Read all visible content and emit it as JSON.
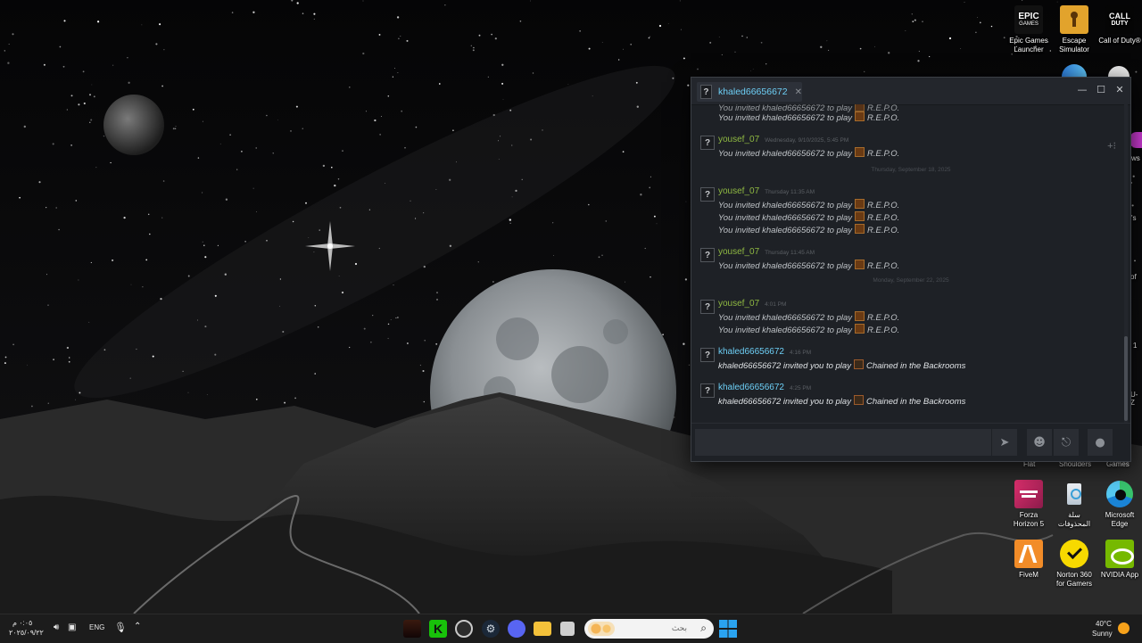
{
  "desktop_icons": [
    {
      "label": "Epic Games Launcher",
      "icon": "epic-games-icon"
    },
    {
      "label": "Escape Simulator",
      "icon": "escape-simulator-icon"
    },
    {
      "label": "Call of Duty®",
      "icon": "call-of-duty-icon"
    },
    {
      "label": "Flat",
      "icon": "flat-icon"
    },
    {
      "label": "Shoulders",
      "icon": "shoulders-icon"
    },
    {
      "label": "Games",
      "icon": "games-icon"
    },
    {
      "label": "Forza Horizon 5",
      "icon": "forza-horizon-icon"
    },
    {
      "label": "سلة المحذوفات",
      "icon": "recycle-bin-icon"
    },
    {
      "label": "Microsoft Edge",
      "icon": "edge-icon"
    },
    {
      "label": "FiveM",
      "icon": "fivem-icon"
    },
    {
      "label": "Norton 360 for Gamers",
      "icon": "norton-icon"
    },
    {
      "label": "NVIDIA App",
      "icon": "nvidia-icon"
    }
  ],
  "icon_texts": {
    "epic_line1": "EPIC",
    "epic_line2": "GAMES",
    "cod_line1": "CALL",
    "cod_line2": "DUTY"
  },
  "partial_labels": [
    "ws",
    "'s",
    "of",
    "1",
    "U-Z",
    "ffr"
  ],
  "chat": {
    "tab_name": "khaled66656672",
    "avatar_glyph": "?",
    "top_clipped_line": "You invited khaled66656672 to play",
    "messages": [
      {
        "sender": "",
        "time": "",
        "lines": [
          "You invited khaled66656672 to play"
        ],
        "game": "R.E.P.O."
      },
      {
        "sender": "yousef_07",
        "time": "Wednesday, 9/10/2025, 5:45 PM",
        "lines": [
          "You invited khaled66656672 to play"
        ],
        "game": "R.E.P.O."
      },
      {
        "sender": "yousef_07",
        "time": "Thursday 11:35 AM",
        "lines": [
          "You invited khaled66656672 to play",
          "You invited khaled66656672 to play",
          "You invited khaled66656672 to play"
        ],
        "game": "R.E.P.O."
      },
      {
        "sender": "yousef_07",
        "time": "Thursday 11:45 AM",
        "lines": [
          "You invited khaled66656672 to play"
        ],
        "game": "R.E.P.O."
      },
      {
        "sender": "yousef_07",
        "time": "4:01 PM",
        "lines": [
          "You invited khaled66656672 to play",
          "You invited khaled66656672 to play"
        ],
        "game": "R.E.P.O."
      },
      {
        "sender": "khaled66656672",
        "time": "4:16 PM",
        "lines": [
          "khaled66656672 invited you to play"
        ],
        "game": "Chained in the Backrooms"
      },
      {
        "sender": "khaled66656672",
        "time": "4:25 PM",
        "lines": [
          "khaled66656672 invited you to play"
        ],
        "game": "Chained in the Backrooms"
      }
    ],
    "date_separators": [
      "Thursday, September 18, 2025",
      "Monday, September 22, 2025"
    ],
    "input_value": "",
    "icons": {
      "send": "send-icon",
      "emoticon": "emoticon-icon",
      "attach": "paperclip-icon",
      "voice": "microphone-icon",
      "add_friend": "add-friend-icon"
    }
  },
  "taskbar": {
    "time": "٠:٠٥ م",
    "date": "٢٠٢٥/٠٩/٢٢",
    "language": "ENG",
    "search_placeholder": "بحث",
    "weather_temp": "40°C",
    "weather_desc": "Sunny"
  }
}
